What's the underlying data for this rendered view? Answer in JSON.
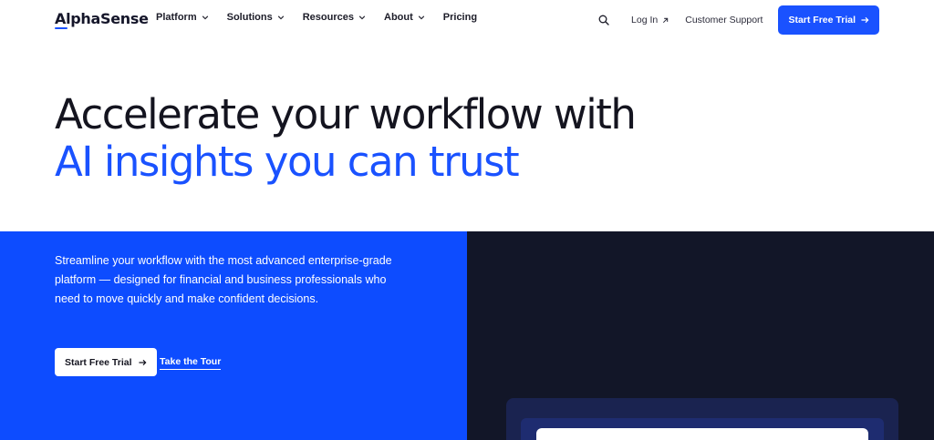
{
  "header": {
    "logo": "AlphaSense",
    "nav": [
      {
        "label": "Platform",
        "has_dropdown": true
      },
      {
        "label": "Solutions",
        "has_dropdown": true
      },
      {
        "label": "Resources",
        "has_dropdown": true
      },
      {
        "label": "About",
        "has_dropdown": true
      },
      {
        "label": "Pricing",
        "has_dropdown": false
      }
    ],
    "login_label": "Log In",
    "support_label": "Customer Support",
    "cta_label": "Start Free Trial"
  },
  "hero": {
    "line1": "Accelerate your workflow with",
    "line2": "AI insights you can trust"
  },
  "intro": {
    "body": "Streamline your workflow with the most advanced enterprise-grade platform — designed for financial and business professionals who need to move quickly and make confident decisions.",
    "primary_cta": "Start Free Trial",
    "secondary_cta": "Take the Tour"
  },
  "colors": {
    "brand_blue": "#1a52ff",
    "panel_blue": "#0d4cff",
    "panel_dark": "#121628"
  },
  "icons": {
    "search": "search-icon",
    "chevron": "chevron-down-icon",
    "external": "arrow-up-right-icon",
    "arrow": "arrow-right-icon"
  }
}
